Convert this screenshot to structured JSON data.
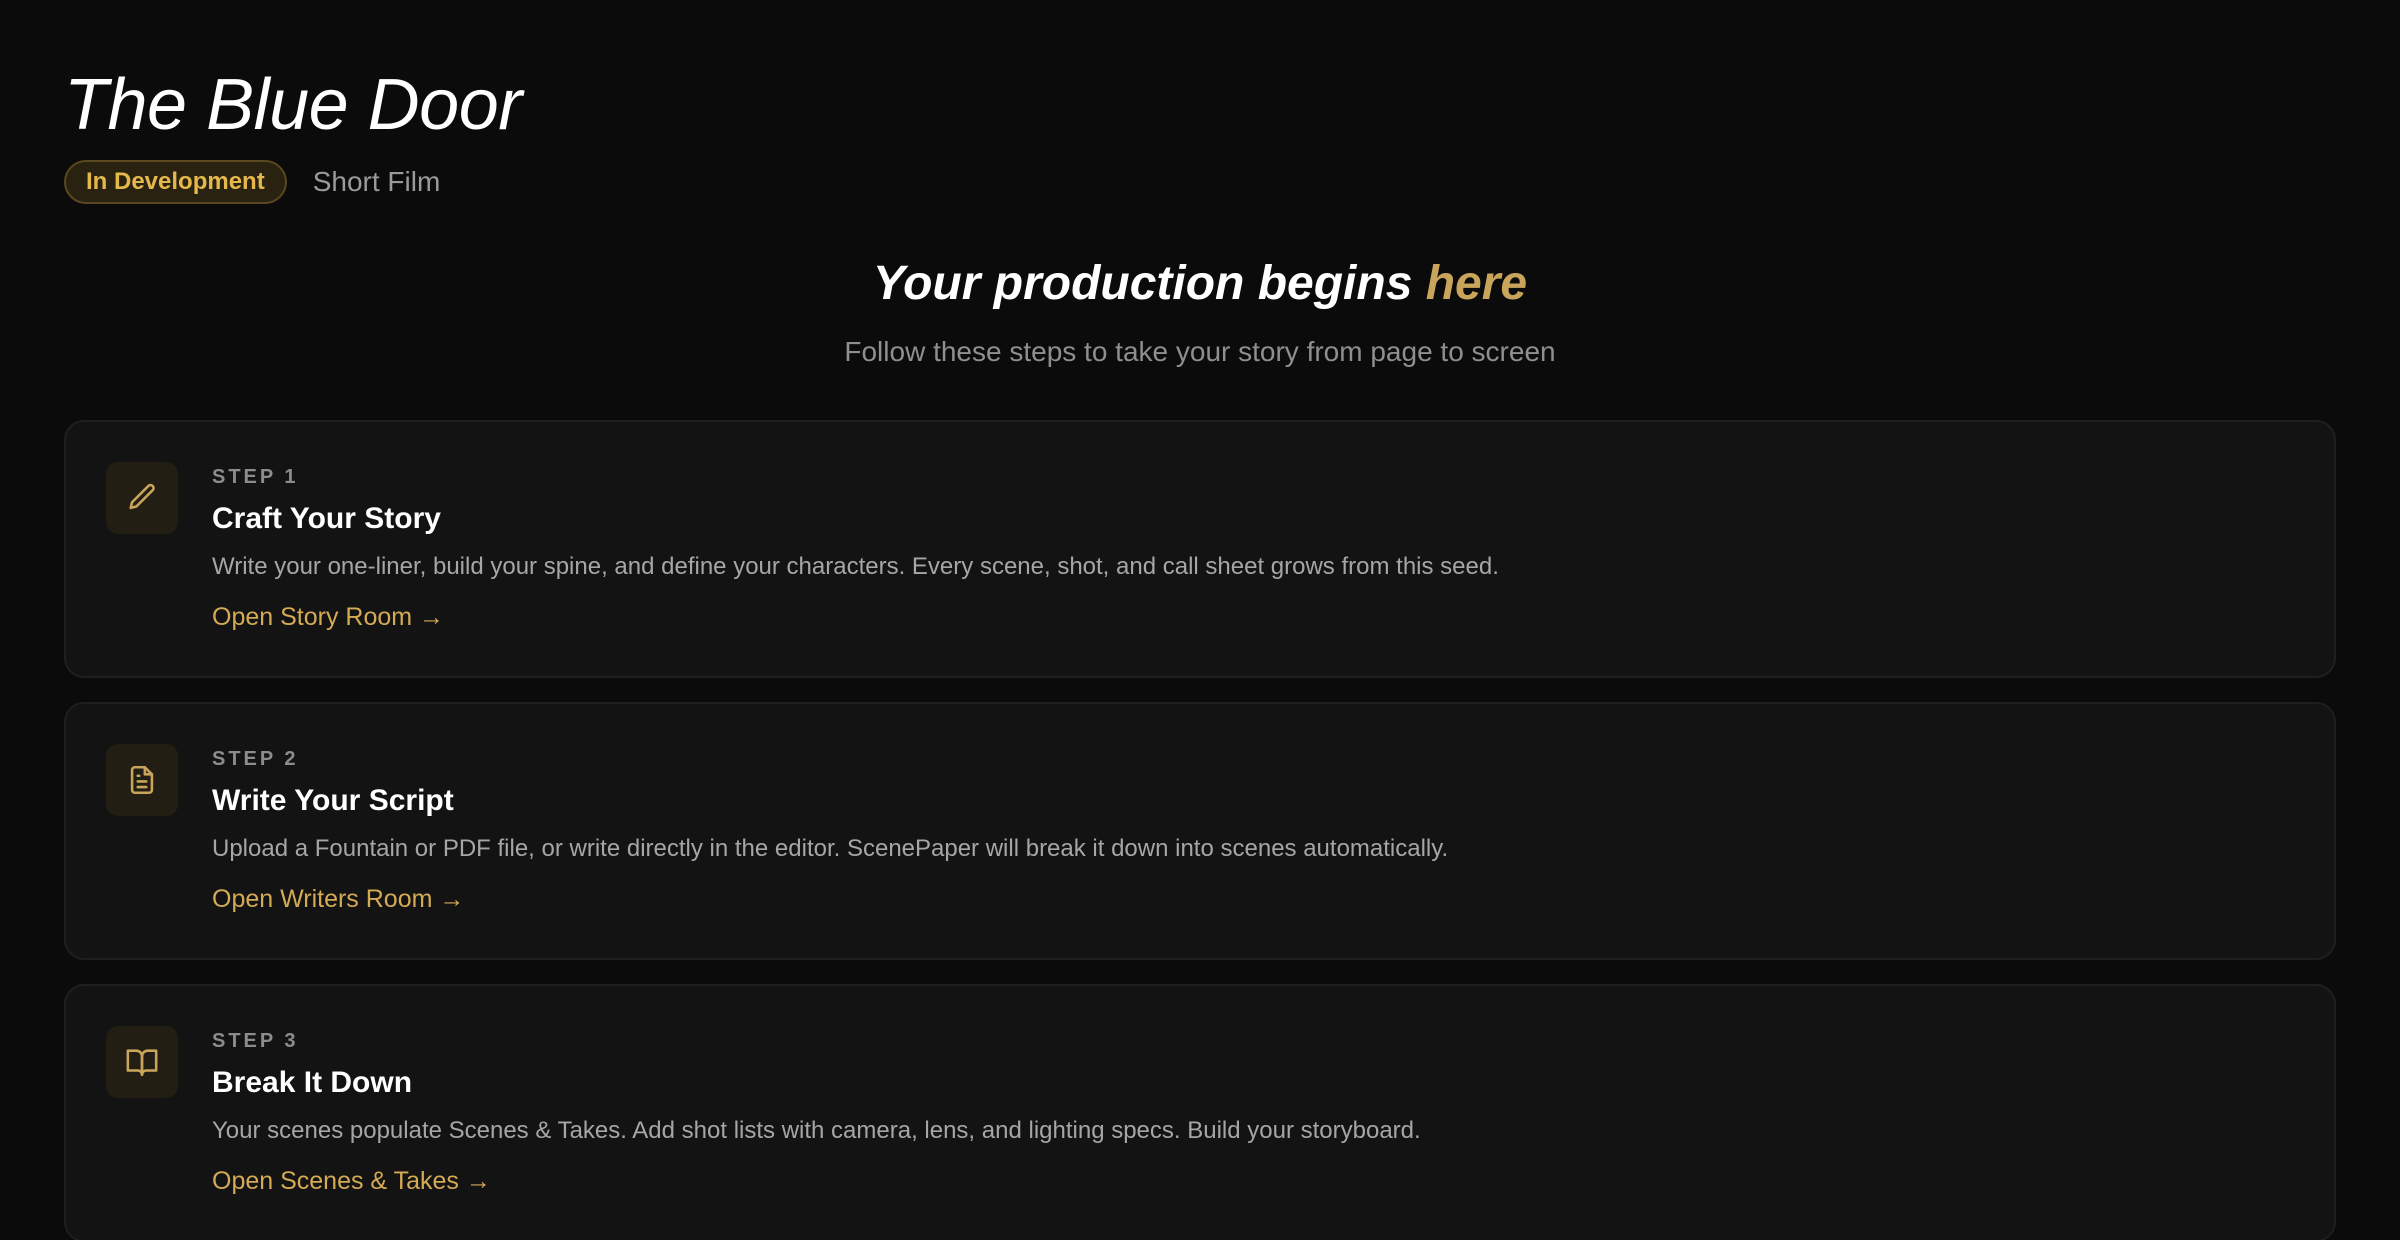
{
  "project": {
    "title": "The Blue Door",
    "status_badge": "In Development",
    "type": "Short Film"
  },
  "hero": {
    "title_main": "Your production begins ",
    "title_accent": "here",
    "subtitle": "Follow these steps to take your story from page to screen"
  },
  "steps": [
    {
      "label": "STEP 1",
      "title": "Craft Your Story",
      "description": "Write your one-liner, build your spine, and define your characters. Every scene, shot, and call sheet grows from this seed.",
      "link": "Open Story Room →",
      "icon": "pencil-icon"
    },
    {
      "label": "STEP 2",
      "title": "Write Your Script",
      "description": "Upload a Fountain or PDF file, or write directly in the editor. ScenePaper will break it down into scenes automatically.",
      "link": "Open Writers Room →",
      "icon": "document-icon"
    },
    {
      "label": "STEP 3",
      "title": "Break It Down",
      "description": "Your scenes populate Scenes & Takes. Add shot lists with camera, lens, and lighting specs. Build your storyboard.",
      "link": "Open Scenes & Takes →",
      "icon": "open-book-icon"
    }
  ],
  "colors": {
    "background": "#0b0b0b",
    "card": "#131313",
    "accent_gold": "#d4aa55",
    "badge_text": "#e4b84b"
  }
}
